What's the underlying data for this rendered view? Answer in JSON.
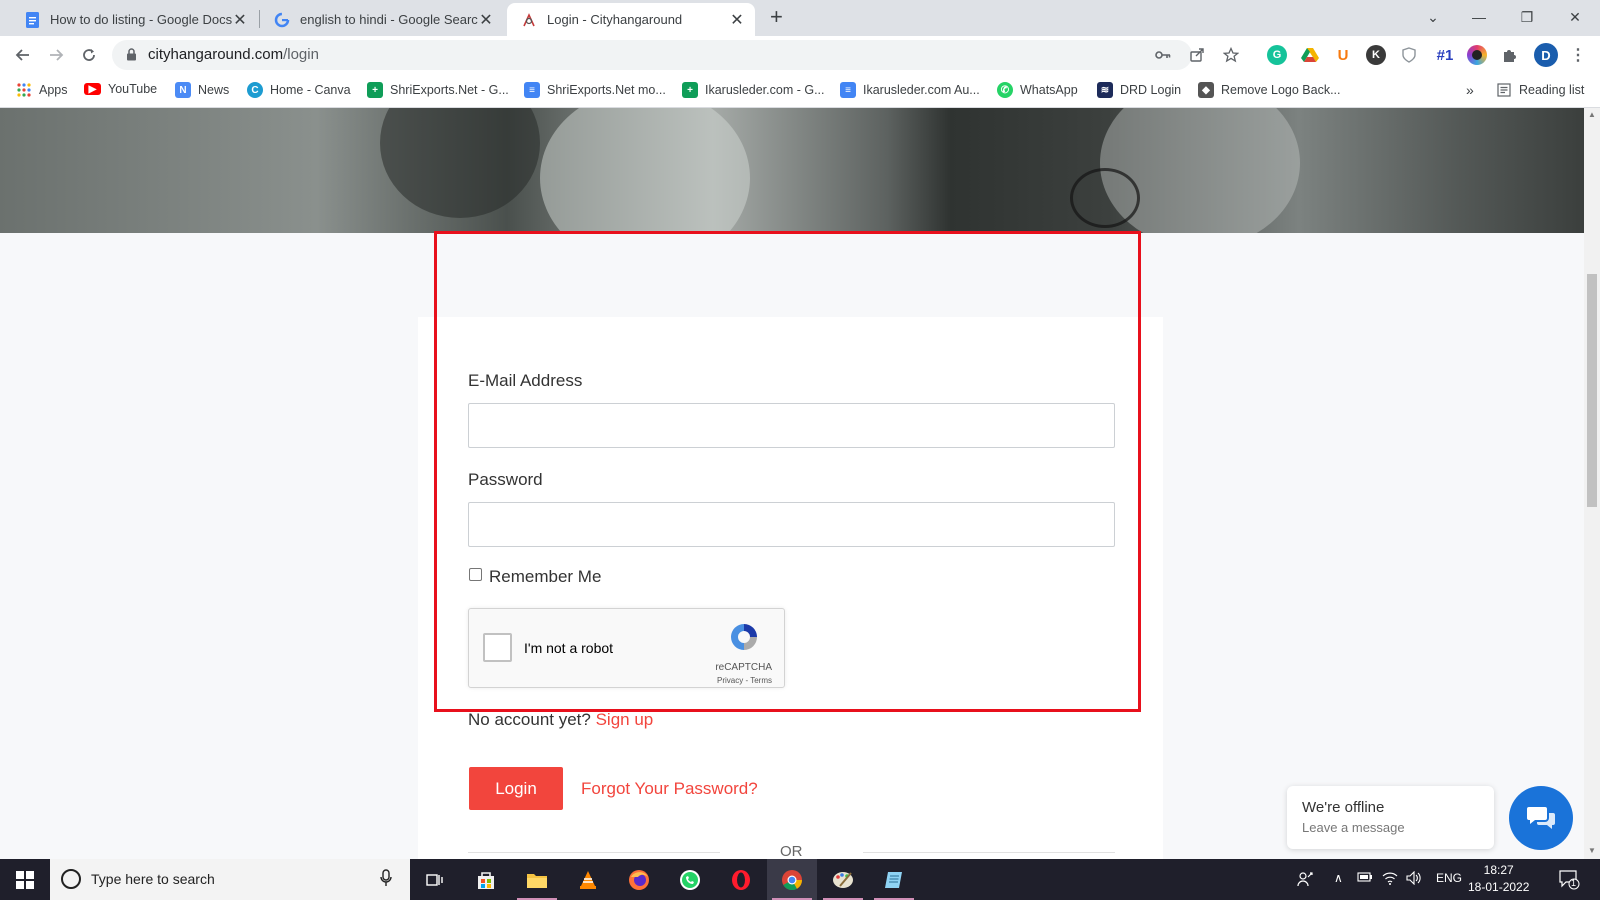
{
  "browser": {
    "tabs": [
      {
        "label": "How to do listing - Google Docs",
        "icon": "google-docs-icon"
      },
      {
        "label": "english to hindi - Google Search",
        "icon": "google-icon"
      },
      {
        "label": "Login - Cityhangaround",
        "icon": "cityhangaround-icon",
        "active": true
      }
    ],
    "url_domain": "cityhangaround.com",
    "url_path": "/login",
    "profile_initial": "D",
    "extension_labels": {
      "hashtag": "#1",
      "k": "K",
      "u": "U"
    },
    "bookmarks": [
      {
        "label": "Apps",
        "icon": "apps-grid-icon"
      },
      {
        "label": "YouTube",
        "icon": "youtube-icon"
      },
      {
        "label": "News",
        "icon": "news-icon"
      },
      {
        "label": "Home - Canva",
        "icon": "canva-icon"
      },
      {
        "label": "ShriExports.Net - G...",
        "icon": "google-sheets-icon"
      },
      {
        "label": "ShriExports.Net mo...",
        "icon": "google-docs-icon"
      },
      {
        "label": "Ikarusleder.com - G...",
        "icon": "google-sheets-icon"
      },
      {
        "label": "Ikarusleder.com Au...",
        "icon": "google-docs-icon"
      },
      {
        "label": "WhatsApp",
        "icon": "whatsapp-icon"
      },
      {
        "label": "DRD Login",
        "icon": "database-icon"
      },
      {
        "label": "Remove Logo Back...",
        "icon": "layers-icon"
      }
    ],
    "bookmarks_overflow": "»",
    "reading_list": "Reading list"
  },
  "login_form": {
    "email_label": "E-Mail Address",
    "email_value": "",
    "password_label": "Password",
    "password_value": "",
    "remember_label": "Remember Me",
    "remember_checked": false,
    "captcha_label": "I'm not a robot",
    "captcha_brand": "reCAPTCHA",
    "captcha_terms": "Privacy - Terms",
    "no_account_text": "No account yet?",
    "signup_link": "Sign up",
    "login_button": "Login",
    "forgot_link": "Forgot Your Password?",
    "or_text": "OR"
  },
  "chat_widget": {
    "title": "We're offline",
    "subtitle": "Leave a message"
  },
  "taskbar": {
    "search_placeholder": "Type here to search",
    "language": "ENG",
    "time": "18:27",
    "date": "18-01-2022",
    "notification_count": "1",
    "apps": [
      "task-view-icon",
      "store-icon",
      "file-explorer-icon",
      "vlc-icon",
      "firefox-icon",
      "whatsapp-icon",
      "opera-icon",
      "chrome-icon",
      "paint-icon",
      "notepad-icon"
    ]
  },
  "colors": {
    "accent": "#f2453d",
    "highlight_border": "#e8101c",
    "chat_blue": "#1a73d9"
  }
}
